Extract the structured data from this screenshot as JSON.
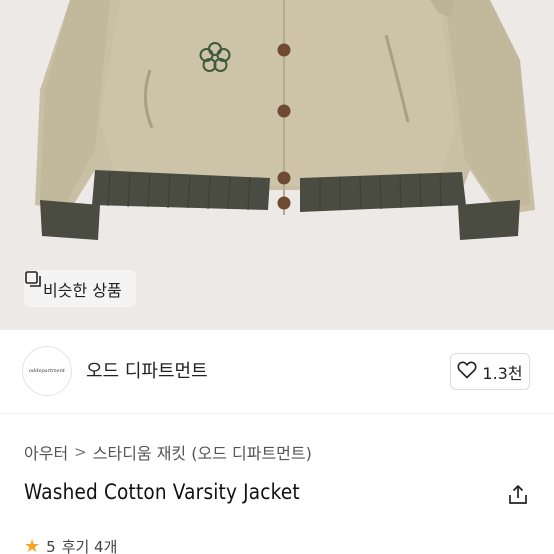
{
  "similar_button": {
    "label": "비슷한 상품",
    "icon": "similar-items-icon"
  },
  "brand": {
    "name": "오드 디파트먼트",
    "logo_text": "oddepartment"
  },
  "like": {
    "count": "1.3천",
    "icon": "heart-icon"
  },
  "breadcrumb": {
    "category": "아우터",
    "subcategory": "스타디움 재킷 (오드 디파트먼트)"
  },
  "product": {
    "title": "Washed Cotton Varsity Jacket"
  },
  "share": {
    "icon": "share-icon"
  },
  "rating": {
    "score": "5",
    "reviews": "후기 4개",
    "icon": "star-icon"
  },
  "colors": {
    "jacket": "#c9bfa4",
    "rib": "#4a4c42",
    "button": "#6e4a32",
    "emblem": "#3f5a3a"
  }
}
